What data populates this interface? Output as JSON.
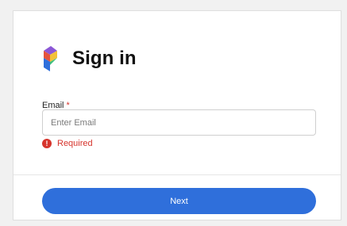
{
  "header": {
    "title": "Sign in",
    "logo_icon": "prism-logo-icon"
  },
  "form": {
    "email_label": "Email",
    "required_marker": "*",
    "email_placeholder": "Enter Email",
    "email_value": "",
    "error_icon": "alert-circle-icon",
    "error_glyph": "!",
    "error_text": "Required"
  },
  "actions": {
    "next_label": "Next"
  },
  "colors": {
    "primary": "#2f6fdb",
    "error": "#d6342c",
    "logo_blue": "#2f6fdb",
    "logo_green": "#3fbf7f",
    "logo_yellow": "#f3c13a",
    "logo_red": "#e5533d",
    "logo_purple": "#8b57d6"
  }
}
